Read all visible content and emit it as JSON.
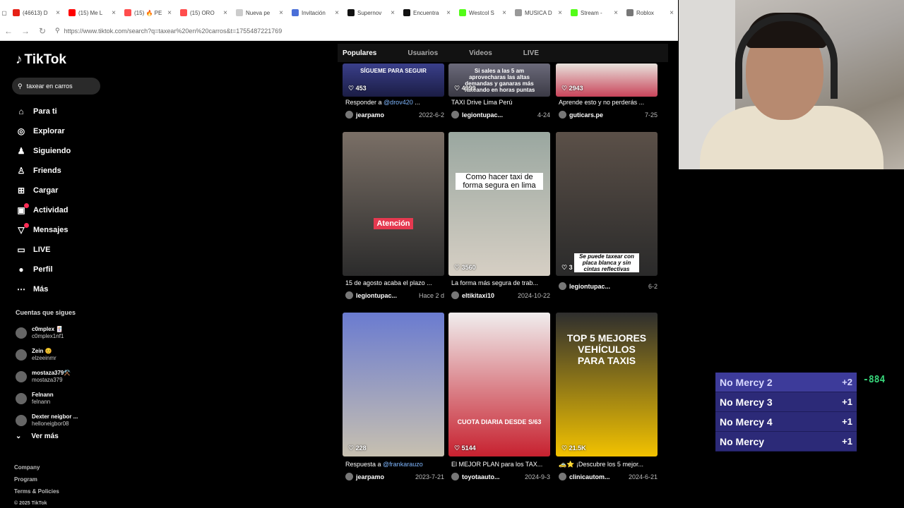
{
  "browser": {
    "tabs": [
      {
        "label": "(46613) D",
        "color": "#e62117"
      },
      {
        "label": "(15) Me L",
        "color": "#ff0000"
      },
      {
        "label": "(15) 🔥 PE",
        "color": "#ff4d4d"
      },
      {
        "label": "(15) ORO",
        "color": "#ff4d4d"
      },
      {
        "label": "Nueva pe",
        "color": "#cccccc"
      },
      {
        "label": "Invitación",
        "color": "#4a6fd8"
      },
      {
        "label": "Supernov",
        "color": "#111111"
      },
      {
        "label": "Encuentra",
        "color": "#111111"
      },
      {
        "label": "Westcol S",
        "color": "#53fc18"
      },
      {
        "label": "MUSICA D",
        "color": "#999999"
      },
      {
        "label": "Stream -",
        "color": "#53fc18"
      },
      {
        "label": "Roblox",
        "color": "#777777"
      }
    ],
    "url": "https://www.tiktok.com/search?q=taxear%20en%20carros&t=1755487221769"
  },
  "sidebar": {
    "logo": "TikTok",
    "search_value": "taxear en carros",
    "nav": [
      {
        "label": "Para ti",
        "icon": "home-icon"
      },
      {
        "label": "Explorar",
        "icon": "compass-icon"
      },
      {
        "label": "Siguiendo",
        "icon": "following-icon"
      },
      {
        "label": "Friends",
        "icon": "friends-icon"
      },
      {
        "label": "Cargar",
        "icon": "upload-icon"
      },
      {
        "label": "Actividad",
        "icon": "activity-icon"
      },
      {
        "label": "Mensajes",
        "icon": "messages-icon"
      },
      {
        "label": "LIVE",
        "icon": "live-icon"
      },
      {
        "label": "Perfil",
        "icon": "profile-icon"
      },
      {
        "label": "Más",
        "icon": "more-icon"
      }
    ],
    "following_title": "Cuentas que sigues",
    "following": [
      {
        "name": "c0mplex 🃏",
        "handle": "c0mplex1nf1"
      },
      {
        "name": "Zein 😊",
        "handle": "elzeeinmr"
      },
      {
        "name": "mostaza379⚒️",
        "handle": "mostaza379"
      },
      {
        "name": "Felnann",
        "handle": "felnann"
      },
      {
        "name": "Dexter neigbor ...",
        "handle": "helloneigbor08"
      }
    ],
    "ver_mas": "Ver más",
    "footer": [
      "Company",
      "Program",
      "Terms & Policies"
    ],
    "copyright": "© 2025 TikTok"
  },
  "results": {
    "tabs": [
      "Populares",
      "Usuarios",
      "Videos",
      "LIVE"
    ],
    "videos": [
      {
        "likes": "453",
        "caption_pre": "Responder a ",
        "mention": "@drov420",
        "caption_post": " ...",
        "author": "jearpamo",
        "date": "2022-6-2",
        "overlay": "SÍGUEME PARA SEGUIR"
      },
      {
        "likes": "4999",
        "caption_pre": "TAXI Drive Lima Perú",
        "mention": "",
        "caption_post": "",
        "author": "legiontupac...",
        "date": "4-24",
        "overlay": "Si sales a las 5 am aprovecharas las altas demandas y ganaras más Taxeando en horas puntas"
      },
      {
        "likes": "2943",
        "caption_pre": "Aprende esto y no perderás ...",
        "mention": "",
        "caption_post": "",
        "author": "guticars.pe",
        "date": "7-25",
        "overlay": ""
      },
      {
        "likes": "",
        "caption_pre": "15 de agosto acaba el plazo ...",
        "mention": "",
        "caption_post": "",
        "author": "legiontupac...",
        "date": "Hace 2 d",
        "overlay": "Atención"
      },
      {
        "likes": "3560",
        "caption_pre": "La forma más segura de trab...",
        "mention": "",
        "caption_post": "",
        "author": "eltikitaxi10",
        "date": "2024-10-22",
        "overlay": "Como hacer taxi de forma segura en lima"
      },
      {
        "likes": "3",
        "caption_pre": "",
        "mention": "",
        "caption_post": "",
        "author": "legiontupac...",
        "date": "6-2",
        "overlay": "Se puede taxear con placa blanca y sin cintas reflectivas"
      },
      {
        "likes": "228",
        "caption_pre": "Respuesta a ",
        "mention": "@frankarauzo",
        "caption_post": "",
        "author": "jearpamo",
        "date": "2023-7-21",
        "overlay": ""
      },
      {
        "likes": "5144",
        "caption_pre": "El MEJOR PLAN para los TAX...",
        "mention": "",
        "caption_post": "",
        "author": "toyotaauto...",
        "date": "2024-9-3",
        "overlay": "CUOTA DIARIA DESDE S/63"
      },
      {
        "likes": "21.5K",
        "caption_pre": "🚕⭐ ¡Descubre los 5 mejor...",
        "mention": "",
        "caption_post": "",
        "author": "clinicautom...",
        "date": "2024-6-21",
        "overlay": "TOP 5 MEJORES VEHÍCULOS PARA TAXIS"
      }
    ]
  },
  "scores": [
    {
      "label": "No Mercy 2",
      "pts": "+2"
    },
    {
      "label": "No Mercy 3",
      "pts": "+1"
    },
    {
      "label": "No Mercy 4",
      "pts": "+1"
    },
    {
      "label": "No Mercy",
      "pts": "+1"
    }
  ],
  "score_delta": "-884"
}
